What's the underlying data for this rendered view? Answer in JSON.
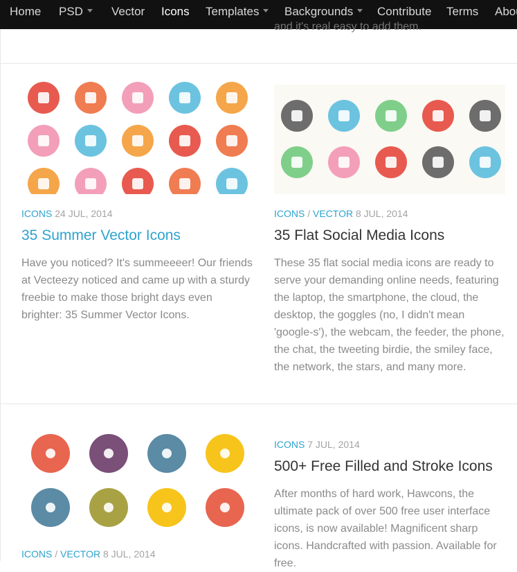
{
  "nav": {
    "items": [
      {
        "label": "Home",
        "dropdown": false
      },
      {
        "label": "PSD",
        "dropdown": true
      },
      {
        "label": "Vector",
        "dropdown": false
      },
      {
        "label": "Icons",
        "dropdown": false,
        "active": true
      },
      {
        "label": "Templates",
        "dropdown": true
      },
      {
        "label": "Backgrounds",
        "dropdown": true
      },
      {
        "label": "Contribute",
        "dropdown": false
      },
      {
        "label": "Terms",
        "dropdown": false
      },
      {
        "label": "About",
        "dropdown": false
      }
    ]
  },
  "top_strip": {
    "text": "and it's real easy to add them."
  },
  "posts": [
    {
      "tags": [
        "ICONS"
      ],
      "date": "24 JUL, 2014",
      "title": "35 Summer Vector Icons",
      "excerpt": "Have you noticed? It's summeeeer! Our friends at Vecteezy noticed and came up with a sturdy freebie to make those bright days even brighter: 35 Summer Vector Icons."
    },
    {
      "tags": [
        "ICONS",
        "VECTOR"
      ],
      "date": "8 JUL, 2014",
      "title": "35 Flat Social Media Icons",
      "excerpt": "These 35 flat social media icons are ready to serve your demanding online needs, featuring the laptop, the smartphone, the cloud, the desktop, the goggles (no, I didn't mean 'google-s'), the webcam, the feeder, the phone, the chat, the tweeting birdie, the smiley face, the network, the stars, and many more."
    },
    {
      "tags": [
        "ICONS"
      ],
      "date": "7 JUL, 2014",
      "title": "500+ Free Filled and Stroke Icons",
      "excerpt": "After months of hard work, Hawcons, the ultimate pack of over 500 free user interface icons, is now available! Magnificent sharp icons. Handcrafted with passion. Available for free."
    },
    {
      "tags": [
        "ICONS",
        "VECTOR"
      ],
      "date": "8 JUL, 2014"
    }
  ],
  "colors": {
    "accent": "#2ea3cf",
    "nav_bg": "#111111",
    "meta": "#a3a3a3",
    "text": "#8a8a8a"
  },
  "thumbnails": {
    "summer_icons": [
      "#e85a4f",
      "#f07c52",
      "#f39fb9",
      "#6cc3e0",
      "#f5a64a",
      "#f39fb9",
      "#6cc3e0",
      "#f5a64a",
      "#e85a4f",
      "#f07c52",
      "#f5a64a",
      "#f39fb9",
      "#e85a4f",
      "#f07c52",
      "#6cc3e0"
    ],
    "social_icons": [
      "#6d6d6d",
      "#6cc3e0",
      "#7fcf8a",
      "#e85a4f",
      "#6d6d6d",
      "#7fcf8a",
      "#f39fb9",
      "#e85a4f",
      "#6d6d6d",
      "#6cc3e0"
    ],
    "food_icons": [
      "#e8654f",
      "#7a4f78",
      "#5b8ba5",
      "#f7c41c",
      "#5b8ba5",
      "#a9a245",
      "#f7c41c",
      "#e8654f"
    ]
  }
}
